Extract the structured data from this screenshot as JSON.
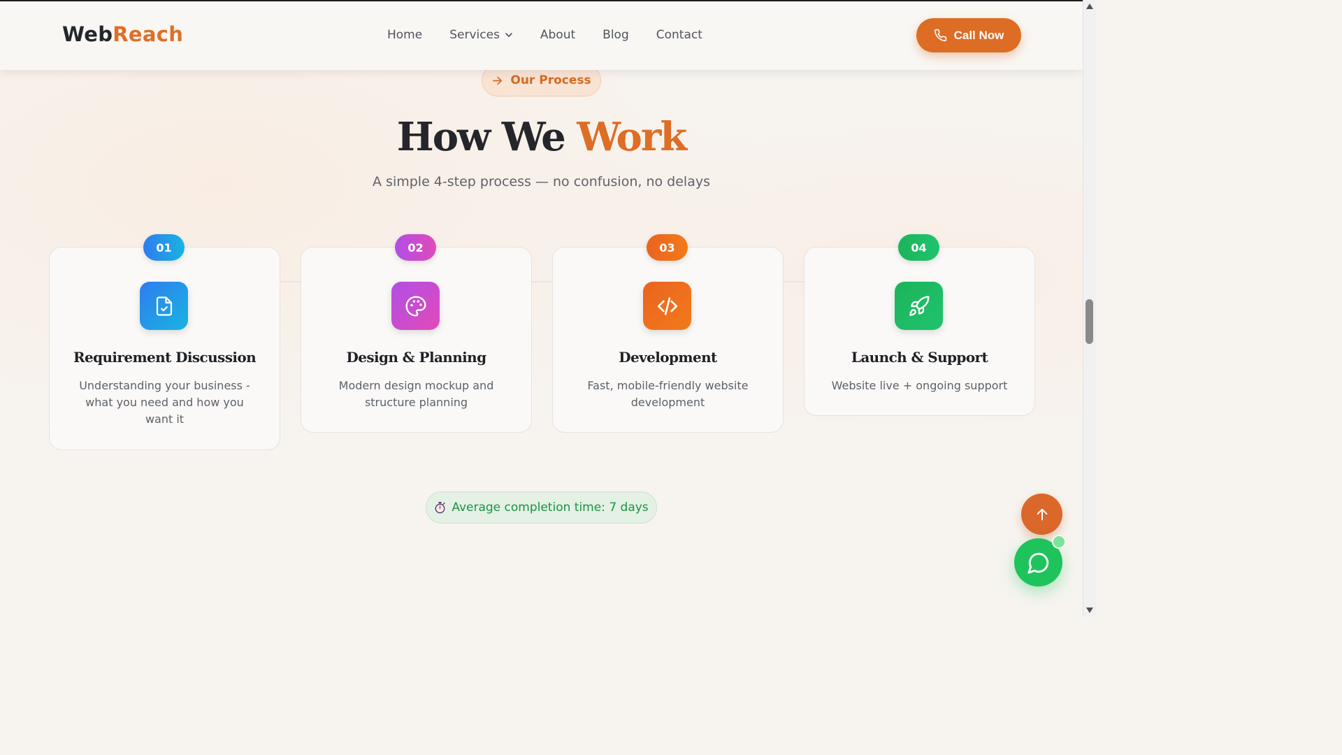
{
  "header": {
    "logo_part1": "Web",
    "logo_part2": "Reach",
    "nav": [
      {
        "label": "Home"
      },
      {
        "label": "Services"
      },
      {
        "label": "About"
      },
      {
        "label": "Blog"
      },
      {
        "label": "Contact"
      }
    ],
    "call_label": "Call Now"
  },
  "section": {
    "pill": "Our Process",
    "title_part1": "How We",
    "title_part2": "Work",
    "subtitle": "A simple 4-step process — no confusion, no delays"
  },
  "steps": [
    {
      "number": "01",
      "icon": "file-check-icon",
      "title": "Requirement Discussion",
      "desc": "Understanding your business - what you need and how you want it",
      "color_start": "#2f7cf0",
      "color_end": "#19b4e0"
    },
    {
      "number": "02",
      "icon": "palette-icon",
      "title": "Design & Planning",
      "desc": "Modern design mockup and structure planning",
      "color_start": "#b14fe6",
      "color_end": "#e14ab8"
    },
    {
      "number": "03",
      "icon": "code-icon",
      "title": "Development",
      "desc": "Fast, mobile-friendly website development",
      "color_start": "#ea6420",
      "color_end": "#f27a1a"
    },
    {
      "number": "04",
      "icon": "rocket-icon",
      "title": "Launch & Support",
      "desc": "Website live + ongoing support",
      "color_start": "#1db35a",
      "color_end": "#1ec46e"
    }
  ],
  "avg_completion": "Average completion time: 7 days",
  "colors": {
    "accent": "#de6d25",
    "chat": "#1fc35c"
  }
}
